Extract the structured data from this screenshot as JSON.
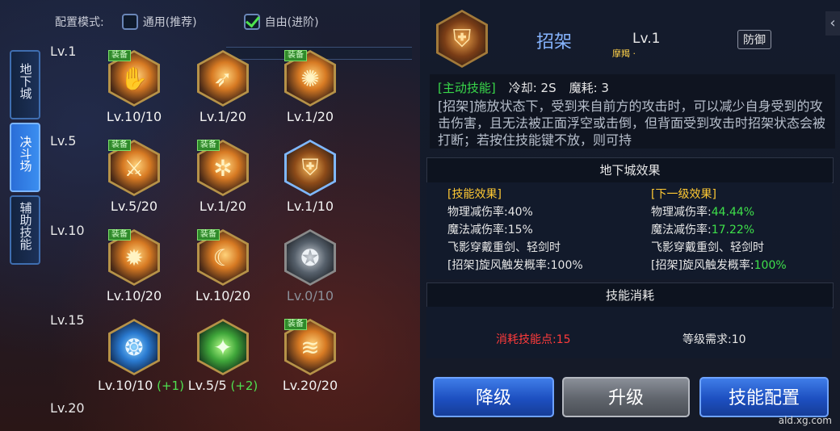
{
  "config": {
    "label": "配置模式:",
    "options": [
      {
        "label": "通用(推荐)",
        "checked": false
      },
      {
        "label": "自由(进阶)",
        "checked": true
      }
    ]
  },
  "side_tabs": [
    "地下城",
    "决斗场",
    "辅助技能"
  ],
  "active_tab": 1,
  "equip_tag": "装备",
  "levels": [
    "Lv.1",
    "Lv.5",
    "Lv.10",
    "Lv.15",
    "Lv.20"
  ],
  "skills": [
    {
      "icon": "claw-slash-icon",
      "glyph": "✋",
      "level": "Lv.10/10",
      "equipped": true,
      "style": "gold"
    },
    {
      "icon": "wind-slash-icon",
      "glyph": "➶",
      "level": "Lv.1/20",
      "equipped": false,
      "style": "gold"
    },
    {
      "icon": "flame-burst-icon",
      "glyph": "✺",
      "level": "Lv.1/20",
      "equipped": true,
      "style": "gold"
    },
    {
      "icon": "sword-strike-icon",
      "glyph": "⚔",
      "level": "Lv.5/20",
      "equipped": true,
      "style": "gold"
    },
    {
      "icon": "whirlwind-icon",
      "glyph": "✲",
      "level": "Lv.1/20",
      "equipped": true,
      "style": "gold"
    },
    {
      "icon": "parry-shield-icon",
      "glyph": "⛨",
      "level": "Lv.1/10",
      "equipped": false,
      "style": "shield"
    },
    {
      "icon": "blade-rush-icon",
      "glyph": "✹",
      "level": "Lv.10/20",
      "equipped": true,
      "style": "gold"
    },
    {
      "icon": "crescent-slash-icon",
      "glyph": "☾",
      "level": "Lv.10/20",
      "equipped": true,
      "style": "gold"
    },
    {
      "icon": "wolf-head-icon",
      "glyph": "✪",
      "level": "Lv.0/10",
      "equipped": false,
      "style": "gray"
    },
    {
      "icon": "orbs-icon",
      "glyph": "❂",
      "level": "Lv.10/10",
      "plus": "(+1)",
      "equipped": false,
      "style": "blue"
    },
    {
      "icon": "green-blade-icon",
      "glyph": "✦",
      "level": "Lv.5/5",
      "plus": "(+2)",
      "equipped": false,
      "style": "green"
    },
    {
      "icon": "wind-wave-icon",
      "glyph": "≋",
      "level": "Lv.20/20",
      "equipped": true,
      "style": "gold"
    }
  ],
  "detail": {
    "name": "招架",
    "level": "Lv.1",
    "sub_tag": "摩羯 ·",
    "type": "防御",
    "active_tag": "[主动技能]",
    "cooldown": "冷却: 2S",
    "mana": "魔耗: 3",
    "description": "[招架]施放状态下，受到来自前方的攻击时，可以减少自身受到的攻击伤害，且无法被正面浮空或击倒，但背面受到攻击时招架状态会被打断；若按住技能键不放，则可持"
  },
  "dungeon_effect": {
    "title": "地下城效果",
    "current": {
      "header": "[技能效果]",
      "lines": [
        {
          "label": "物理减伤率:",
          "value": "40%"
        },
        {
          "label": "魔法减伤率:",
          "value": "15%"
        },
        {
          "label": "飞影穿戴重剑、轻剑时",
          "value": ""
        },
        {
          "label": "[招架]旋风触发概率:",
          "value": "100%"
        }
      ]
    },
    "next": {
      "header": "[下一级效果]",
      "lines": [
        {
          "label": "物理减伤率:",
          "value": "44.44%"
        },
        {
          "label": "魔法减伤率:",
          "value": "17.22%"
        },
        {
          "label": "飞影穿戴重剑、轻剑时",
          "value": ""
        },
        {
          "label": "[招架]旋风触发概率:",
          "value": "100%"
        }
      ]
    }
  },
  "consumption": {
    "title": "技能消耗",
    "points": "消耗技能点:15",
    "requirement": "等级需求:10"
  },
  "buttons": {
    "downgrade": "降级",
    "upgrade": "升级",
    "config": "技能配置"
  },
  "watermark": "ald.xg.com"
}
